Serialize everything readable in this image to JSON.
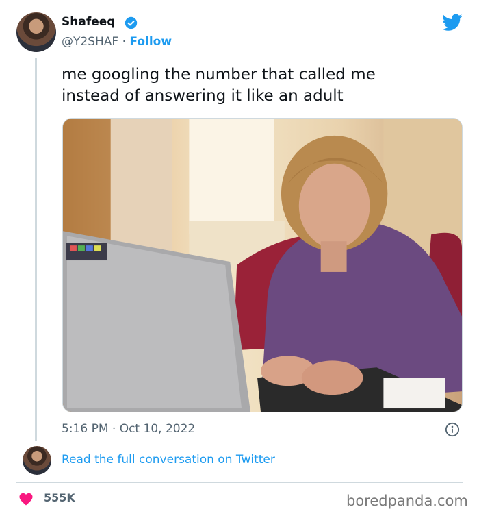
{
  "author": {
    "name": "Shafeeq",
    "handle": "@Y2SHAF",
    "separator": " · ",
    "follow_label": "Follow"
  },
  "tweet": {
    "text": "me googling the number that called me\ninstead of answering it like an adult",
    "timestamp": "5:16 PM · Oct 10, 2022"
  },
  "conversation_link": "Read the full conversation on Twitter",
  "likes": "555K",
  "watermark": "boredpanda.com",
  "icons": {
    "verified": "verified-badge-icon",
    "brand": "twitter-bird-icon",
    "info": "info-icon",
    "like": "heart-icon"
  },
  "colors": {
    "accent": "#1d9bf0",
    "like": "#f91880",
    "text": "#0f1419",
    "muted": "#536471"
  }
}
